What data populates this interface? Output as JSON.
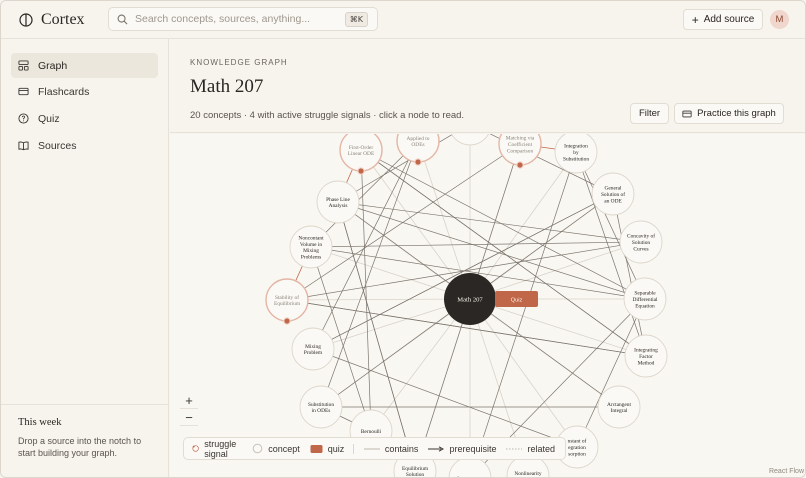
{
  "app": {
    "name": "Cortex",
    "user_initial": "M"
  },
  "search": {
    "placeholder": "Search concepts, sources, anything...",
    "shortcut": "⌘K"
  },
  "header": {
    "add_source_label": "Add source"
  },
  "sidebar": {
    "items": [
      {
        "label": "Graph",
        "icon": "graph-icon",
        "active": true
      },
      {
        "label": "Flashcards",
        "icon": "cards-icon",
        "active": false
      },
      {
        "label": "Quiz",
        "icon": "help-circle-icon",
        "active": false
      },
      {
        "label": "Sources",
        "icon": "book-icon",
        "active": false
      }
    ],
    "week": {
      "title": "This week",
      "text": "Drop a source into the notch to start building your graph."
    }
  },
  "page": {
    "kicker": "KNOWLEDGE GRAPH",
    "title": "Math 207",
    "subtitle": "20 concepts · 4 with active struggle signals · click a node to read.",
    "filter_label": "Filter",
    "practice_label": "Practice this graph"
  },
  "graph": {
    "center": {
      "label": "Math 207"
    },
    "quiz_tag": "Quiz",
    "nodes": [
      {
        "id": "first-order",
        "lines": [
          "First-Order",
          "Linear ODE"
        ],
        "struggle": true
      },
      {
        "id": "applied",
        "lines": [
          "Applied to",
          "ODEs"
        ],
        "struggle": true
      },
      {
        "id": "matching",
        "lines": [
          "Matching via",
          "Coefficient",
          "Comparison"
        ],
        "struggle": true
      },
      {
        "id": "integration-sub",
        "lines": [
          "Integration",
          "by",
          "Substitution"
        ],
        "struggle": false
      },
      {
        "id": "general-solution",
        "lines": [
          "General",
          "Solution of",
          "an ODE"
        ],
        "struggle": false
      },
      {
        "id": "concavity",
        "lines": [
          "Concavity of",
          "Solution",
          "Curves"
        ],
        "struggle": false
      },
      {
        "id": "separable",
        "lines": [
          "Separable",
          "Differential",
          "Equation"
        ],
        "struggle": false
      },
      {
        "id": "integrating-factor",
        "lines": [
          "Integrating",
          "Factor",
          "Method"
        ],
        "struggle": false
      },
      {
        "id": "arctangent",
        "lines": [
          "Arctangent",
          "Integral"
        ],
        "struggle": false
      },
      {
        "id": "constant-integration",
        "lines": [
          "nstant of",
          "egration",
          "sorption"
        ],
        "struggle": false
      },
      {
        "id": "nonlinearity",
        "lines": [
          "Nonlinearity",
          "in"
        ],
        "struggle": false
      },
      {
        "id": "autonomous",
        "lines": [
          "Autonomous"
        ],
        "struggle": false
      },
      {
        "id": "equilibrium",
        "lines": [
          "Equilibrium",
          "Solution"
        ],
        "struggle": false
      },
      {
        "id": "bernoulli",
        "lines": [
          "Bernoulli"
        ],
        "struggle": false
      },
      {
        "id": "substitution-odes",
        "lines": [
          "Substitution",
          "in ODEs"
        ],
        "struggle": false
      },
      {
        "id": "mixing",
        "lines": [
          "Mixing",
          "Problem"
        ],
        "struggle": false
      },
      {
        "id": "stability",
        "lines": [
          "Stability of",
          "Equilibrium"
        ],
        "struggle": true
      },
      {
        "id": "noncontant-volume",
        "lines": [
          "Noncontant",
          "Volume in",
          "Mixing",
          "Problems"
        ],
        "struggle": false
      },
      {
        "id": "phase-line",
        "lines": [
          "Phase Line",
          "Analysis"
        ],
        "struggle": false
      },
      {
        "id": "top-partial",
        "lines": [],
        "struggle": false
      }
    ]
  },
  "legend": {
    "struggle": "struggle signal",
    "concept": "concept",
    "quiz": "quiz",
    "contains": "contains",
    "prerequisite": "prerequisite",
    "related": "related"
  },
  "credit": "React Flow",
  "colors": {
    "accent": "#c0674a",
    "node_dark": "#2b2724",
    "background": "#f7f4ee"
  }
}
